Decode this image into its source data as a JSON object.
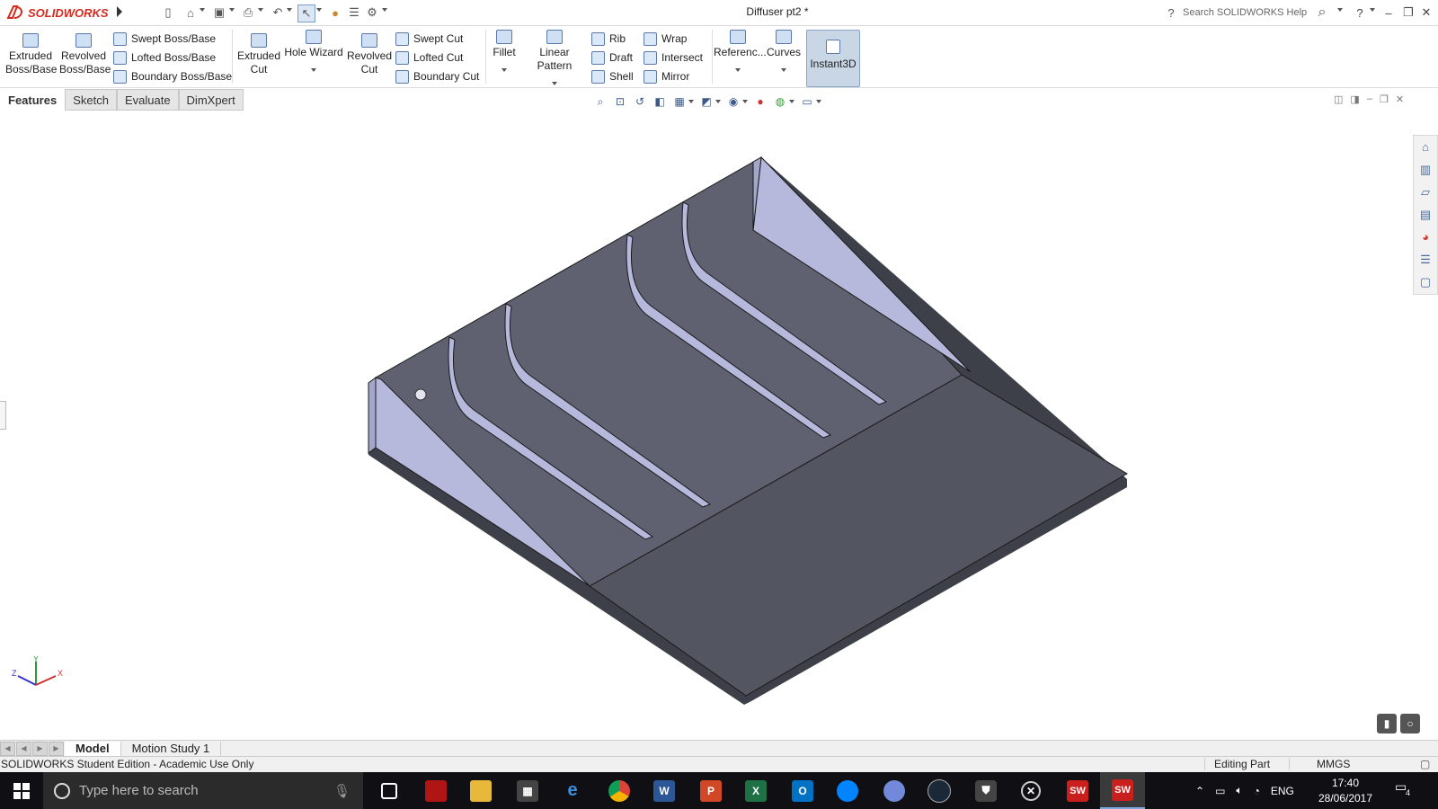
{
  "app": {
    "brand": "SOLIDWORKS",
    "doc_title": "Diffuser pt2 *",
    "help_search_placeholder": "Search SOLIDWORKS Help"
  },
  "ribbon": {
    "extruded_boss": "Extruded Boss/Base",
    "revolved_boss": "Revolved Boss/Base",
    "swept_boss": "Swept Boss/Base",
    "lofted_boss": "Lofted Boss/Base",
    "boundary_boss": "Boundary Boss/Base",
    "extruded_cut": "Extruded Cut",
    "hole_wizard": "Hole Wizard",
    "revolved_cut": "Revolved Cut",
    "swept_cut": "Swept Cut",
    "lofted_cut": "Lofted Cut",
    "boundary_cut": "Boundary Cut",
    "fillet": "Fillet",
    "linear_pattern": "Linear Pattern",
    "rib": "Rib",
    "draft": "Draft",
    "shell": "Shell",
    "wrap": "Wrap",
    "intersect": "Intersect",
    "mirror": "Mirror",
    "reference": "Referenc...",
    "curves": "Curves",
    "instant3d": "Instant3D"
  },
  "tabs": [
    "Features",
    "Sketch",
    "Evaluate",
    "DimXpert"
  ],
  "triad": {
    "x": "X",
    "y": "Y",
    "z": "Z"
  },
  "bottom_tabs": [
    "Model",
    "Motion Study 1"
  ],
  "status": {
    "edition": "SOLIDWORKS Student Edition - Academic Use Only",
    "editing": "Editing Part",
    "units": "MMGS"
  },
  "taskbar": {
    "search_placeholder": "Type here to search",
    "lang": "ENG",
    "time": "17:40",
    "date": "28/06/2017",
    "notifications": "4",
    "apps": [
      "task-view",
      "acrobat",
      "file-explorer",
      "calculator",
      "edge",
      "chrome",
      "word",
      "powerpoint",
      "excel",
      "outlook",
      "messenger",
      "discord",
      "steam",
      "world-of-tanks",
      "xbox",
      "solidworks-2016",
      "solidworks-2016-active"
    ]
  },
  "colors": {
    "brand_red": "#d52b1e",
    "part_top": "#5f6170",
    "part_fin": "#b6b9dc",
    "taskbar": "#101014"
  }
}
